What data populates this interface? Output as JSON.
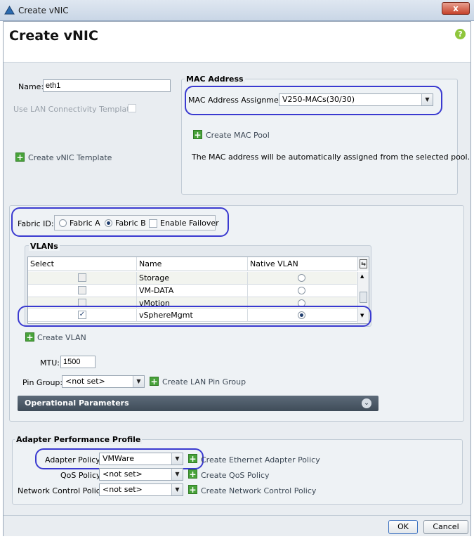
{
  "window": {
    "title": "Create vNIC",
    "close_label": "x"
  },
  "header": {
    "title": "Create vNIC",
    "help_label": "?"
  },
  "name": {
    "label": "Name:",
    "value": "eth1"
  },
  "lan_template": {
    "label": "Use LAN Connectivity Template:"
  },
  "create_vnic_template": "Create vNIC Template",
  "mac": {
    "section_title": "MAC Address",
    "assignment_label": "MAC Address Assignment:",
    "assignment_value": "V250-MACs(30/30)",
    "create_pool": "Create MAC Pool",
    "info": "The MAC address will be automatically assigned from the selected pool."
  },
  "fabric": {
    "label": "Fabric ID:",
    "option_a": "Fabric A",
    "option_b": "Fabric B",
    "selected": "Fabric B",
    "failover_label": "Enable Failover"
  },
  "vlans": {
    "section_title": "VLANs",
    "columns": [
      "Select",
      "Name",
      "Native VLAN"
    ],
    "rows": [
      {
        "name": "Storage",
        "selected": false,
        "native": false
      },
      {
        "name": "VM-DATA",
        "selected": false,
        "native": false
      },
      {
        "name": "vMotion",
        "selected": false,
        "native": false
      },
      {
        "name": "vSphereMgmt",
        "selected": true,
        "native": true
      }
    ]
  },
  "create_vlan": "Create VLAN",
  "mtu": {
    "label": "MTU:",
    "value": "1500"
  },
  "pin_group": {
    "label": "Pin Group:",
    "value": "<not set>",
    "create": "Create LAN Pin Group"
  },
  "operational": {
    "label": "Operational Parameters"
  },
  "adapter": {
    "section_title": "Adapter Performance Profile",
    "adapter_policy": {
      "label": "Adapter Policy:",
      "value": "VMWare",
      "create": "Create Ethernet Adapter Policy"
    },
    "qos_policy": {
      "label": "QoS Policy:",
      "value": "<not set>",
      "create": "Create QoS Policy"
    },
    "network_control": {
      "label": "Network Control Policy:",
      "value": "<not set>",
      "create": "Create Network Control Policy"
    }
  },
  "footer": {
    "ok": "OK",
    "cancel": "Cancel"
  },
  "colors": {
    "annotation": "#3a3ad0",
    "add_icon": "#48a23a"
  }
}
